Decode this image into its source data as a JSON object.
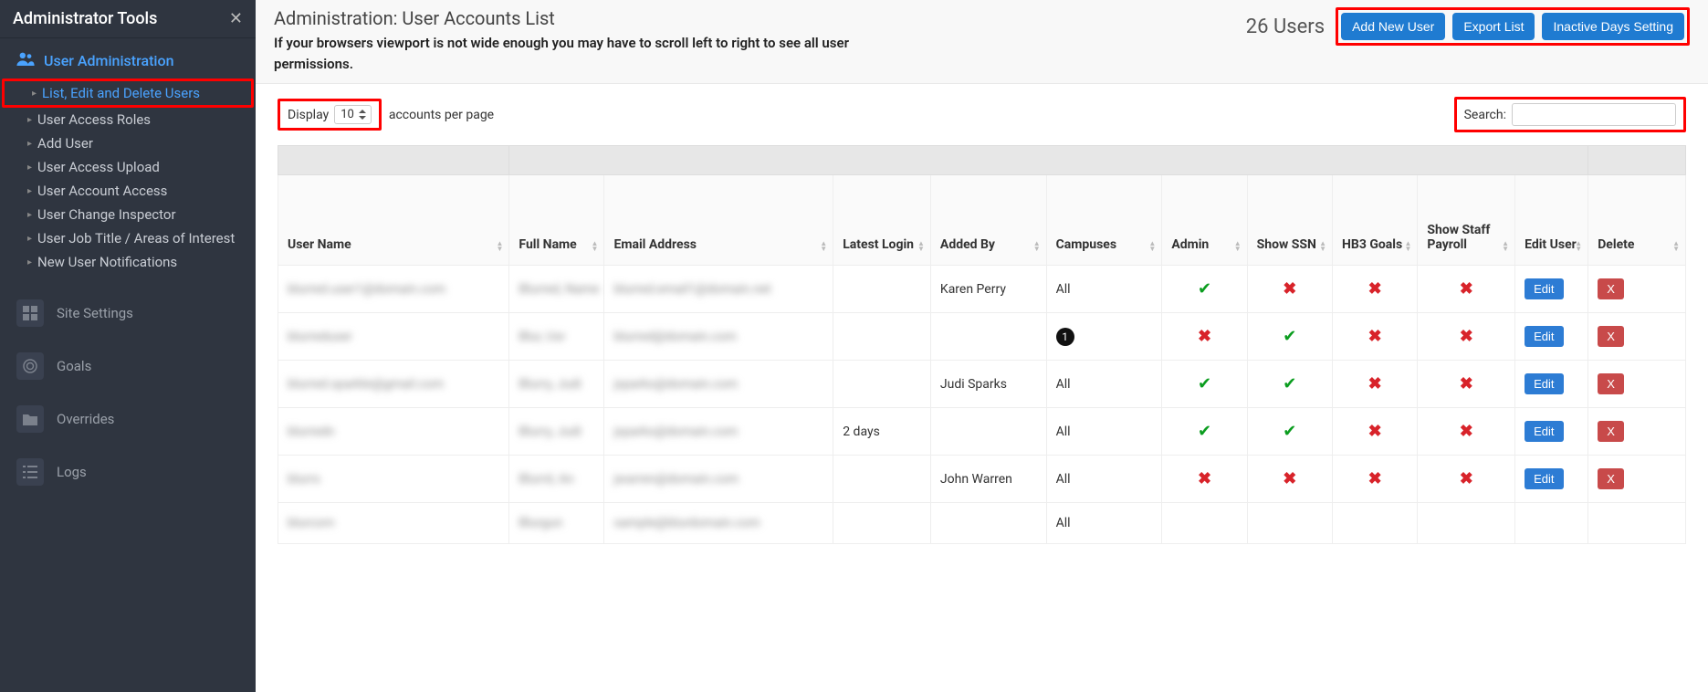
{
  "sidebar": {
    "title": "Administrator Tools",
    "group": "User Administration",
    "items": [
      {
        "label": "List, Edit and Delete Users",
        "active": true
      },
      {
        "label": "User Access Roles",
        "active": false
      },
      {
        "label": "Add User",
        "active": false
      },
      {
        "label": "User Access Upload",
        "active": false
      },
      {
        "label": "User Account Access",
        "active": false
      },
      {
        "label": "User Change Inspector",
        "active": false
      },
      {
        "label": "User Job Title / Areas of Interest",
        "active": false
      },
      {
        "label": "New User Notifications",
        "active": false
      }
    ],
    "lower": [
      {
        "label": "Site Settings"
      },
      {
        "label": "Goals"
      },
      {
        "label": "Overrides"
      },
      {
        "label": "Logs"
      }
    ]
  },
  "header": {
    "title": "Administration: User Accounts List",
    "subtitle": "If your browsers viewport is not wide enough you may have to scroll left to right to see all user permissions.",
    "count": "26 Users",
    "buttons": {
      "add": "Add New User",
      "export": "Export List",
      "inactive": "Inactive Days Setting"
    }
  },
  "controls": {
    "display_label": "Display",
    "display_value": "10",
    "display_suffix": "accounts per page",
    "search_label": "Search:",
    "search_value": ""
  },
  "columns": [
    "User Name",
    "Full Name",
    "Email Address",
    "Latest Login",
    "Added By",
    "Campuses",
    "Admin",
    "Show SSN",
    "HB3 Goals",
    "Show Staff Payroll",
    "Edit User",
    "Delete"
  ],
  "rows": [
    {
      "user": "blurred.user1@domain.com",
      "name": "Blurred, Name",
      "email": "blurred.email1@domain.net",
      "login": "",
      "added": "Karen Perry",
      "campus": "All",
      "admin": true,
      "ssn": false,
      "hb3": false,
      "pay": false,
      "edit": "Edit",
      "del": "X"
    },
    {
      "user": "blurreduser",
      "name": "Blur, Usr",
      "email": "blurred@domain.com",
      "login": "",
      "added": "",
      "campus_badge": "1",
      "admin": false,
      "ssn": true,
      "hb3": false,
      "pay": false,
      "edit": "Edit",
      "del": "X"
    },
    {
      "user": "blurred.sparkle@gmail.com",
      "name": "Blurry, Judi",
      "email": "jsparks@domain.com",
      "login": "",
      "added": "Judi Sparks",
      "campus": "All",
      "admin": true,
      "ssn": true,
      "hb3": false,
      "pay": false,
      "edit": "Edit",
      "del": "X"
    },
    {
      "user": "blurredn",
      "name": "Blurry, Judi",
      "email": "jsparks@domain.com",
      "login": "2 days",
      "added": "",
      "campus": "All",
      "admin": true,
      "ssn": true,
      "hb3": false,
      "pay": false,
      "edit": "Edit",
      "del": "X"
    },
    {
      "user": "blurrs",
      "name": "Blurrd, An",
      "email": "jwarren@domain.com",
      "login": "",
      "added": "John Warren",
      "campus": "All",
      "admin": false,
      "ssn": false,
      "hb3": false,
      "pay": false,
      "edit": "Edit",
      "del": "X"
    },
    {
      "user": "blurcorn",
      "name": "Blurgun",
      "email": "sample@blurdomain.com",
      "login": "",
      "added": "",
      "campus": "All",
      "admin": null,
      "ssn": null,
      "hb3": null,
      "pay": null,
      "edit": "",
      "del": ""
    }
  ]
}
